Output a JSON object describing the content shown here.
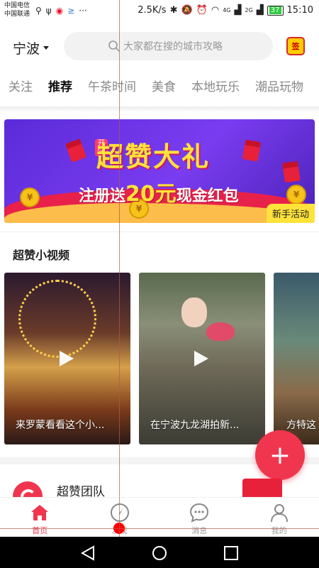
{
  "status_bar": {
    "carrier_1": "中国电信",
    "carrier_2": "中国联通",
    "net_speed": "2.5K/s",
    "signal_1": "4G",
    "signal_2": "2G",
    "battery": "37",
    "time": "15:10",
    "more": "···"
  },
  "header": {
    "city": "宁波",
    "search_placeholder": "大家都在搜的城市攻略",
    "sign_label": "签"
  },
  "tabs": [
    {
      "label": "关注",
      "active": false
    },
    {
      "label": "推荐",
      "active": true
    },
    {
      "label": "午茶时间",
      "active": false
    },
    {
      "label": "美食",
      "active": false
    },
    {
      "label": "本地玩乐",
      "active": false
    },
    {
      "label": "潮品玩物",
      "active": false
    }
  ],
  "banner": {
    "kai_xue": "开学",
    "title": "超赞大礼",
    "register": "注册送",
    "amount": "20元",
    "cash": "现金红包",
    "tag": "新手活动"
  },
  "videos_section": {
    "title": "超赞小视频",
    "items": [
      {
        "caption": "来罗蒙看看这个小..."
      },
      {
        "caption": "在宁波九龙湖拍新..."
      },
      {
        "caption": "方特这"
      }
    ]
  },
  "fab": {
    "label": "+"
  },
  "feed": {
    "name": "超赞团队"
  },
  "bottom_nav": [
    {
      "label": "首页",
      "icon": "home-icon",
      "active": true
    },
    {
      "label": "发现",
      "icon": "compass-icon",
      "active": false
    },
    {
      "label": "消息",
      "icon": "message-icon",
      "active": false
    },
    {
      "label": "我的",
      "icon": "profile-icon",
      "active": false
    }
  ],
  "colors": {
    "accent": "#f0364e",
    "banner_purple": "#6a32e0",
    "banner_yellow": "#ffe23a"
  }
}
